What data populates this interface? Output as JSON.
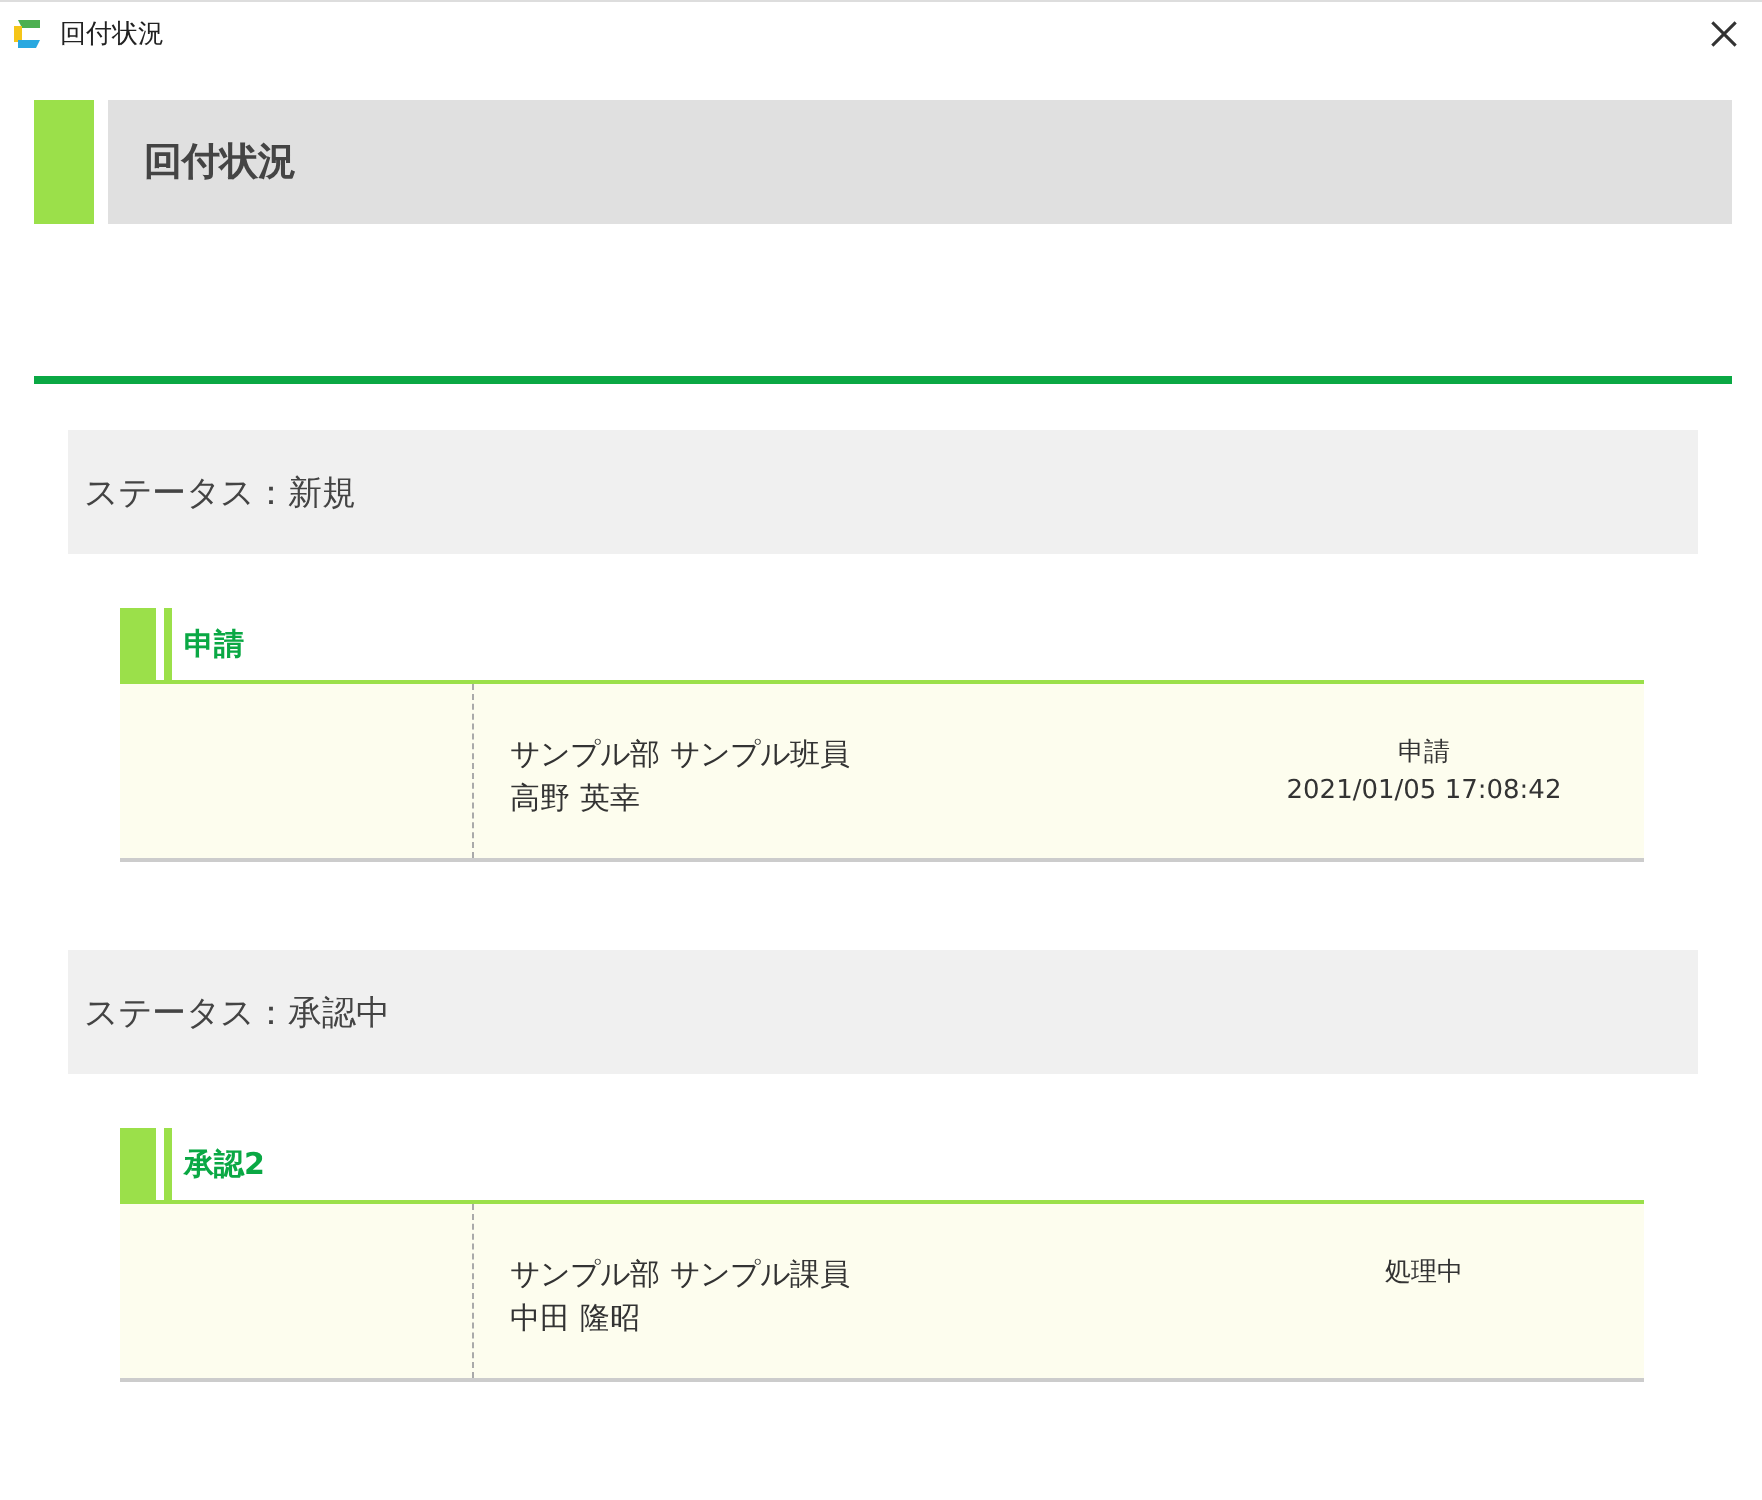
{
  "window": {
    "title": "回付状況"
  },
  "page_title": "回付状況",
  "sections": [
    {
      "status": "ステータス：新規",
      "steps": [
        {
          "name": "申請",
          "organization": "サンプル部 サンプル班員",
          "person": "高野 英幸",
          "action": "申請",
          "datetime": "2021/01/05 17:08:42"
        }
      ]
    },
    {
      "status": "ステータス：承認中",
      "steps": [
        {
          "name": "承認2",
          "organization": "サンプル部 サンプル課員",
          "person": "中田 隆昭",
          "action": "処理中"
        }
      ]
    }
  ]
}
